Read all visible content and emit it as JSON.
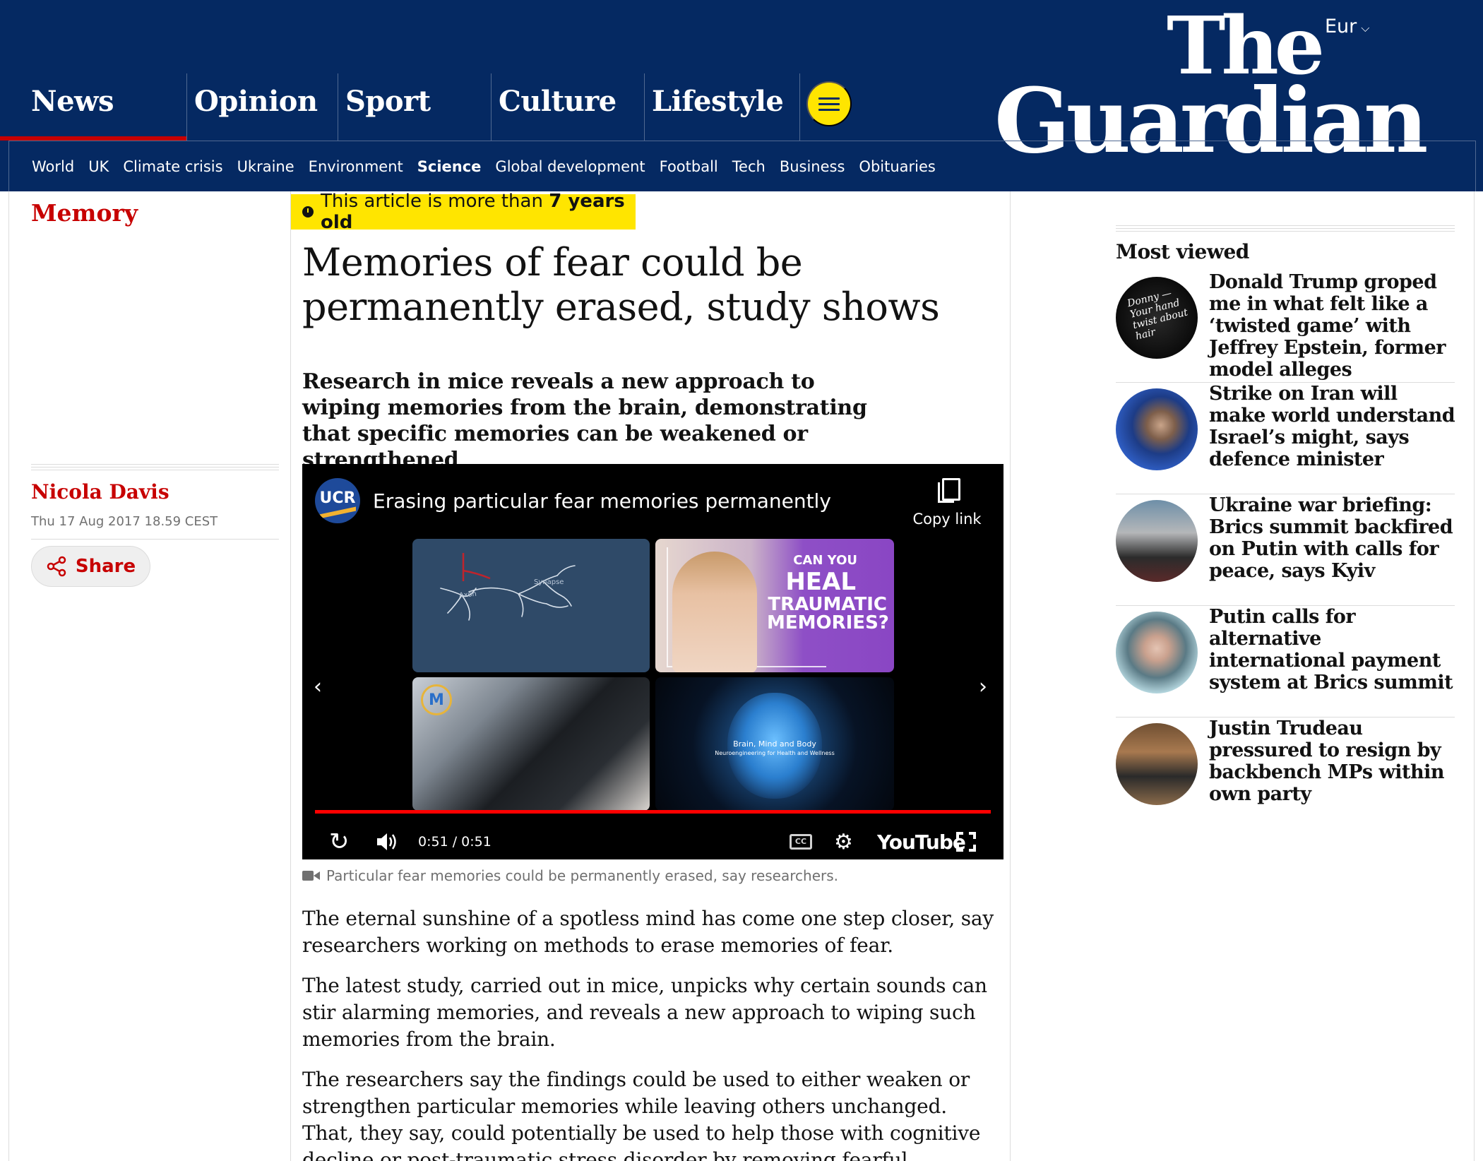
{
  "masthead": {
    "edition": "Eur",
    "logo_line1": "The",
    "logo_line2": "Guardian",
    "pillars": [
      {
        "label": "News",
        "active": true
      },
      {
        "label": "Opinion",
        "active": false
      },
      {
        "label": "Sport",
        "active": false
      },
      {
        "label": "Culture",
        "active": false
      },
      {
        "label": "Lifestyle",
        "active": false
      }
    ],
    "subnav": [
      "World",
      "UK",
      "Climate crisis",
      "Ukraine",
      "Environment",
      "Science",
      "Global development",
      "Football",
      "Tech",
      "Business",
      "Obituaries"
    ],
    "subnav_active": "Science",
    "colors": {
      "brand": "#052962",
      "accent": "#c70000",
      "menu": "#ffe500"
    }
  },
  "article": {
    "section": "Memory",
    "age_notice_prefix": "This article is more than",
    "age_notice_bold": "7 years old",
    "headline": "Memories of fear could be permanently erased, study shows",
    "standfirst": "Research in mice reveals a new approach to wiping memories from the brain, demonstrating that specific memories can be weakened or strengthened",
    "author": "Nicola Davis",
    "date": "Thu 17 Aug 2017 18.59 CEST",
    "share_label": "Share",
    "caption": "Particular fear memories could be permanently erased, say researchers.",
    "paragraphs": [
      "The eternal sunshine of a spotless mind has come one step closer, say researchers working on methods to erase memories of fear.",
      "The latest study, carried out in mice, unpicks why certain sounds can stir alarming memories, and reveals a new approach to wiping such memories from the brain.",
      "The researchers say the findings could be used to either weaken or strengthen particular memories while leaving others unchanged. That, they say, could potentially be used to help those with cognitive decline or post-traumatic stress disorder by removing fearful memories while retaining"
    ]
  },
  "video": {
    "channel_badge": "UCR",
    "title": "Erasing particular fear memories permanently",
    "copy_link_label": "Copy link",
    "time": "0:51 / 0:51",
    "progress": 1.0,
    "youtube_label": "YouTube",
    "cc_label": "CC",
    "thumbs": {
      "t1_axon": "Axon",
      "t1_synapse": "Synapse",
      "t2_line1": "CAN YOU",
      "t2_line2": "HEAL",
      "t2_line3": "TRAUMATIC MEMORIES?",
      "t3_badge": "M",
      "t4_line1": "Brain, Mind and Body",
      "t4_line2": "Neuroengineering for Health and Wellness"
    }
  },
  "most_viewed": {
    "title": "Most viewed",
    "items": [
      {
        "headline": "Donald Trump groped me in what felt like a ‘twisted game’ with Jeffrey Epstein, former model alleges",
        "thumb_text": "Donny — Your hand twist about hair"
      },
      {
        "headline": "Strike on Iran will make world understand Israel’s might, says defence minister"
      },
      {
        "headline": "Ukraine war briefing: Brics summit backfired on Putin with calls for peace, says Kyiv"
      },
      {
        "headline": "Putin calls for alternative international payment system at Brics summit"
      },
      {
        "headline": "Justin Trudeau pressured to resign by backbench MPs within own party"
      }
    ]
  }
}
